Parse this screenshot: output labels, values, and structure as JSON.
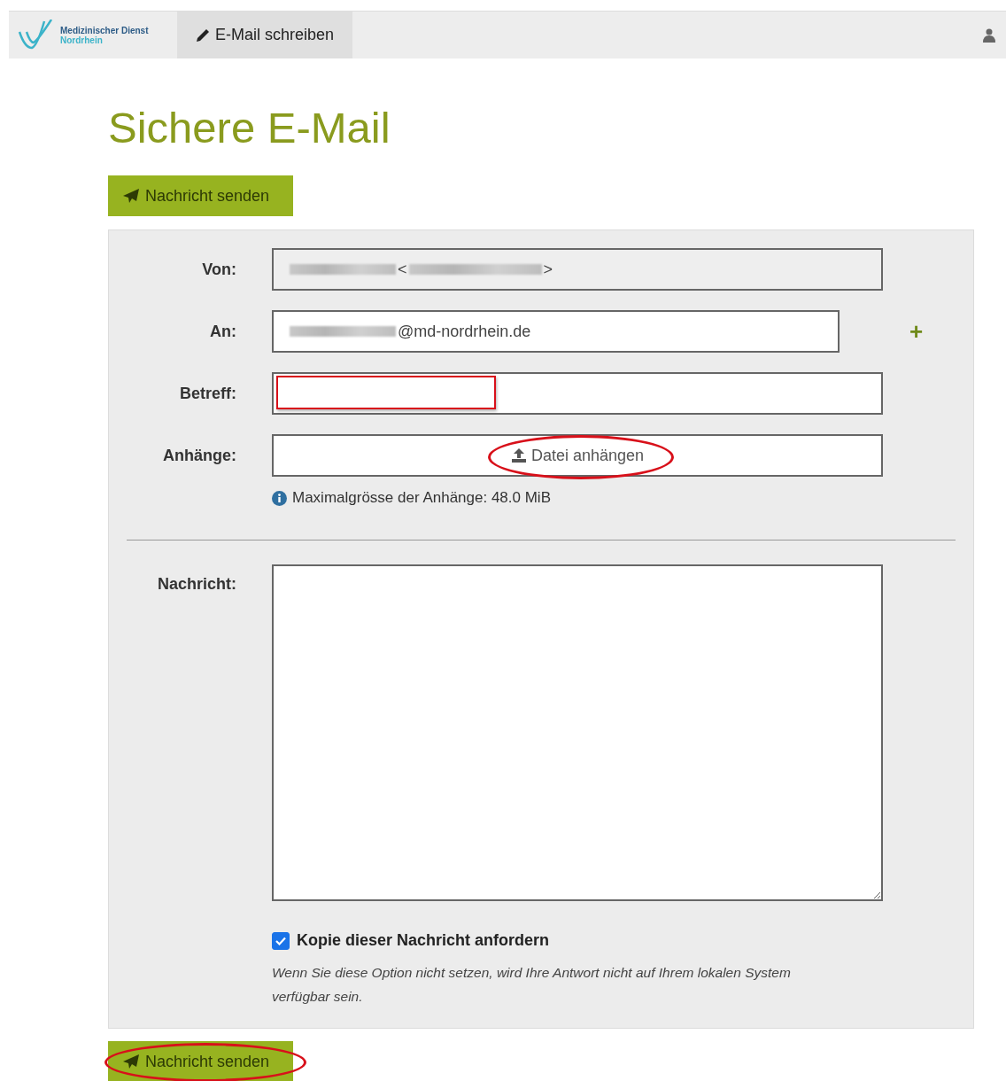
{
  "header": {
    "logo": {
      "line1": "Medizinischer Dienst",
      "line2": "Nordrhein"
    },
    "tabs": [
      {
        "label": "E-Mail schreiben",
        "selected": true
      }
    ]
  },
  "title": "Sichere E-Mail",
  "send_button_top": {
    "label": "Nachricht senden",
    "marked": false
  },
  "form": {
    "fields": [
      {
        "kind": "readonly",
        "label": "Von:",
        "segments": [
          {
            "kind": "redacted"
          },
          {
            "kind": "text",
            "text": "<"
          },
          {
            "kind": "redacted"
          },
          {
            "kind": "text",
            "text": ">"
          }
        ],
        "marked": false
      },
      {
        "kind": "recipient",
        "label": "An:",
        "segments": [
          {
            "kind": "redacted"
          },
          {
            "kind": "text",
            "text": "@md-nordrhein.de"
          }
        ],
        "add_button": "+",
        "marked": false
      },
      {
        "kind": "input",
        "label": "Betreff:",
        "marked": true
      },
      {
        "kind": "upload",
        "label": "Anhänge:",
        "button": "Datei anhängen",
        "marked": true,
        "info": "Maximalgrösse der Anhänge: 48.0 MiB"
      }
    ],
    "message": {
      "label": "Nachricht:"
    },
    "copy": {
      "label": "Kopie dieser Nachricht anfordern",
      "checked": true,
      "note": "Wenn Sie diese Option nicht setzen, wird Ihre Antwort nicht auf Ihrem lokalen System verfügbar sein."
    }
  },
  "send_button_bottom": {
    "label": "Nachricht senden",
    "marked": true
  }
}
